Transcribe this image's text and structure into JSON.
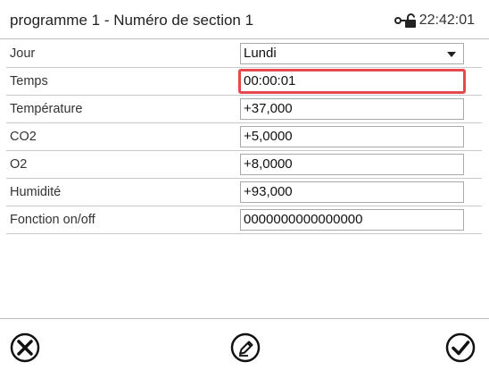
{
  "header": {
    "title": "programme 1 - Numéro de section 1",
    "time": "22:42:01",
    "lock_icon": "unlocked-padlock-key-icon"
  },
  "rows": [
    {
      "label": "Jour",
      "value": "Lundi",
      "type": "select"
    },
    {
      "label": "Temps",
      "value": "00:00:01",
      "type": "input",
      "focused": true
    },
    {
      "label": "Température",
      "value": "+37,000",
      "type": "input"
    },
    {
      "label": "CO2",
      "value": "+5,0000",
      "type": "input"
    },
    {
      "label": "O2",
      "value": "+8,0000",
      "type": "input"
    },
    {
      "label": "Humidité",
      "value": "+93,000",
      "type": "input"
    },
    {
      "label": "Fonction on/off",
      "value": "0000000000000000",
      "type": "input"
    }
  ],
  "footer": {
    "cancel_icon": "close-circle-icon",
    "edit_icon": "pencil-circle-icon",
    "confirm_icon": "check-circle-icon"
  },
  "colors": {
    "focus_border": "#e5484d",
    "text": "#222222"
  }
}
